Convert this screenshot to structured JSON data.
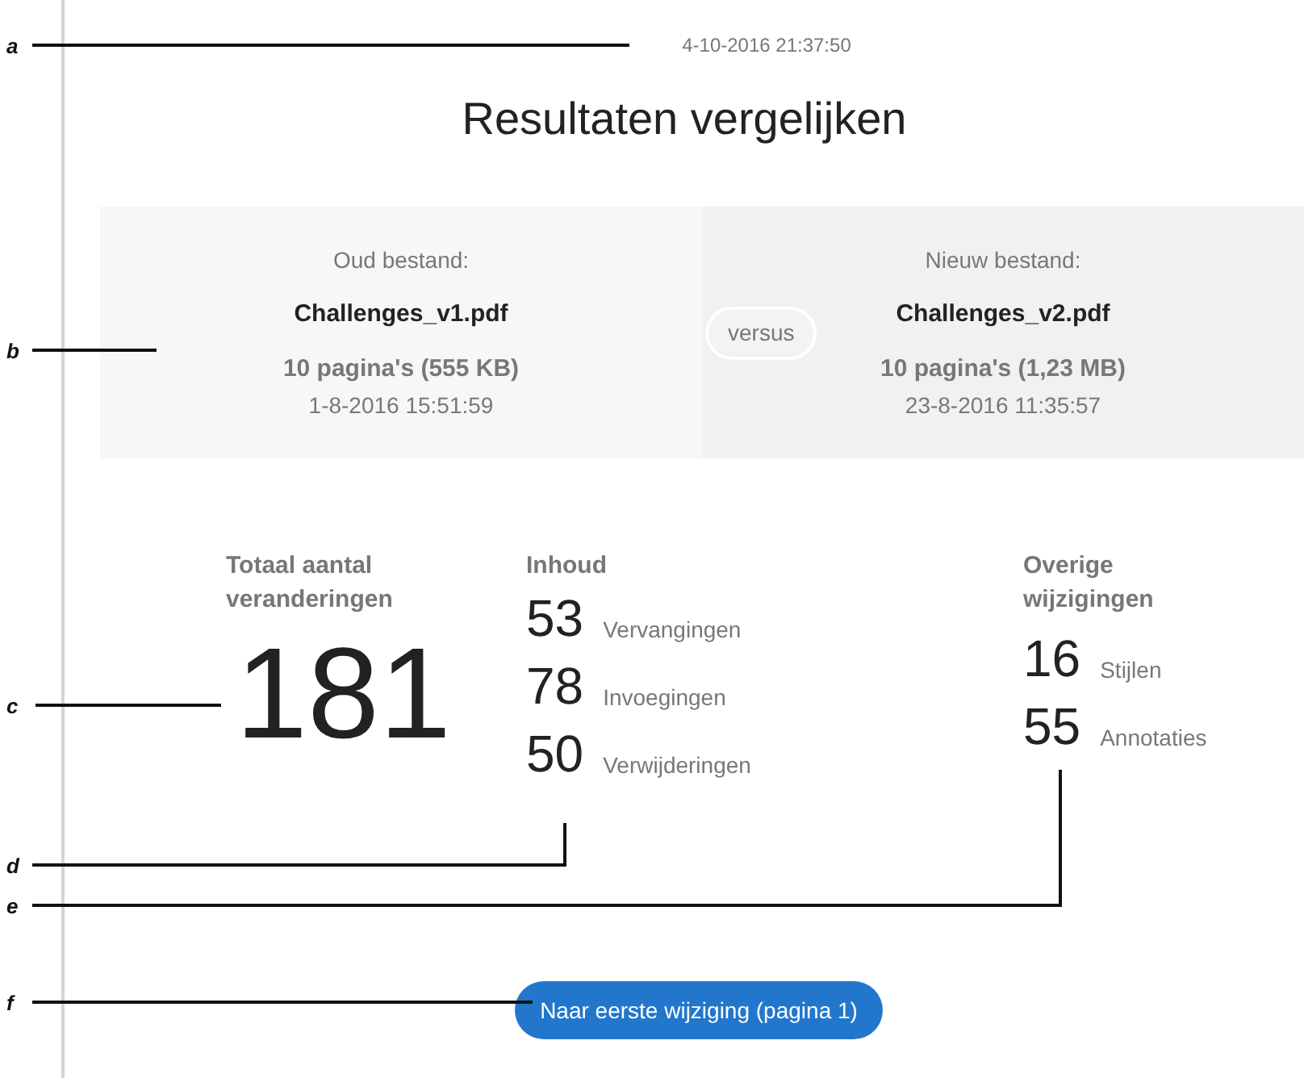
{
  "timestamp": "4-10-2016 21:37:50",
  "title": "Resultaten vergelijken",
  "old_file": {
    "label": "Oud bestand:",
    "name": "Challenges_v1.pdf",
    "pages": "10 pagina's (555 KB)",
    "date": "1-8-2016 15:51:59"
  },
  "versus": "versus",
  "new_file": {
    "label": "Nieuw bestand:",
    "name": "Challenges_v2.pdf",
    "pages": "10 pagina's (1,23 MB)",
    "date": "23-8-2016 11:35:57"
  },
  "total": {
    "heading": "Totaal aantal veranderingen",
    "value": "181"
  },
  "content": {
    "heading": "Inhoud",
    "items": [
      {
        "count": "53",
        "label": "Vervangingen"
      },
      {
        "count": "78",
        "label": "Invoegingen"
      },
      {
        "count": "50",
        "label": "Verwijderingen"
      }
    ]
  },
  "other": {
    "heading": "Overige wijzigingen",
    "items": [
      {
        "count": "16",
        "label": "Stijlen"
      },
      {
        "count": "55",
        "label": "Annotaties"
      }
    ]
  },
  "button": "Naar eerste wijziging (pagina 1)",
  "callouts": [
    "a",
    "b",
    "c",
    "d",
    "e",
    "f"
  ]
}
